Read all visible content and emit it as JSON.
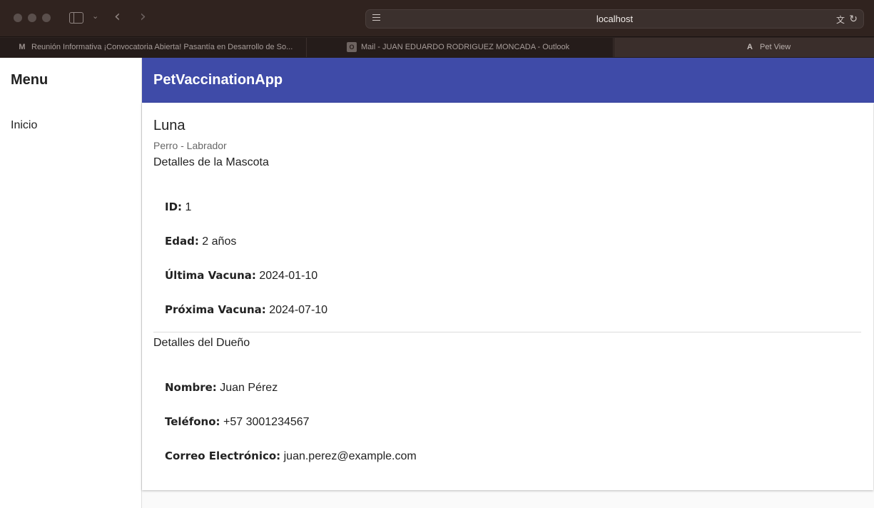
{
  "browser": {
    "url": "localhost",
    "tabs": [
      {
        "label": "Reunión Informativa ¡Convocatoria Abierta! Pasantía en Desarrollo de So...",
        "icon": "gmail-icon"
      },
      {
        "label": "Mail - JUAN EDUARDO RODRIGUEZ MONCADA - Outlook",
        "icon": "outlook-icon"
      },
      {
        "label": "Pet View",
        "icon": "angular-icon"
      }
    ]
  },
  "sidebar": {
    "title": "Menu",
    "items": [
      {
        "label": "Inicio"
      }
    ]
  },
  "header": {
    "title": "PetVaccinationApp",
    "color": "#3f4ba8"
  },
  "pet": {
    "name": "Luna",
    "subtitle": "Perro - Labrador",
    "section_title": "Detalles de la Mascota",
    "fields": [
      {
        "label": "ID:",
        "value": "1"
      },
      {
        "label": "Edad:",
        "value": "2 años"
      },
      {
        "label": "Última Vacuna:",
        "value": "2024-01-10"
      },
      {
        "label": "Próxima Vacuna:",
        "value": "2024-07-10"
      }
    ]
  },
  "owner": {
    "section_title": "Detalles del Dueño",
    "fields": [
      {
        "label": "Nombre:",
        "value": "Juan Pérez"
      },
      {
        "label": "Teléfono:",
        "value": "+57 3001234567"
      },
      {
        "label": "Correo Electrónico:",
        "value": "juan.perez@example.com"
      }
    ]
  }
}
